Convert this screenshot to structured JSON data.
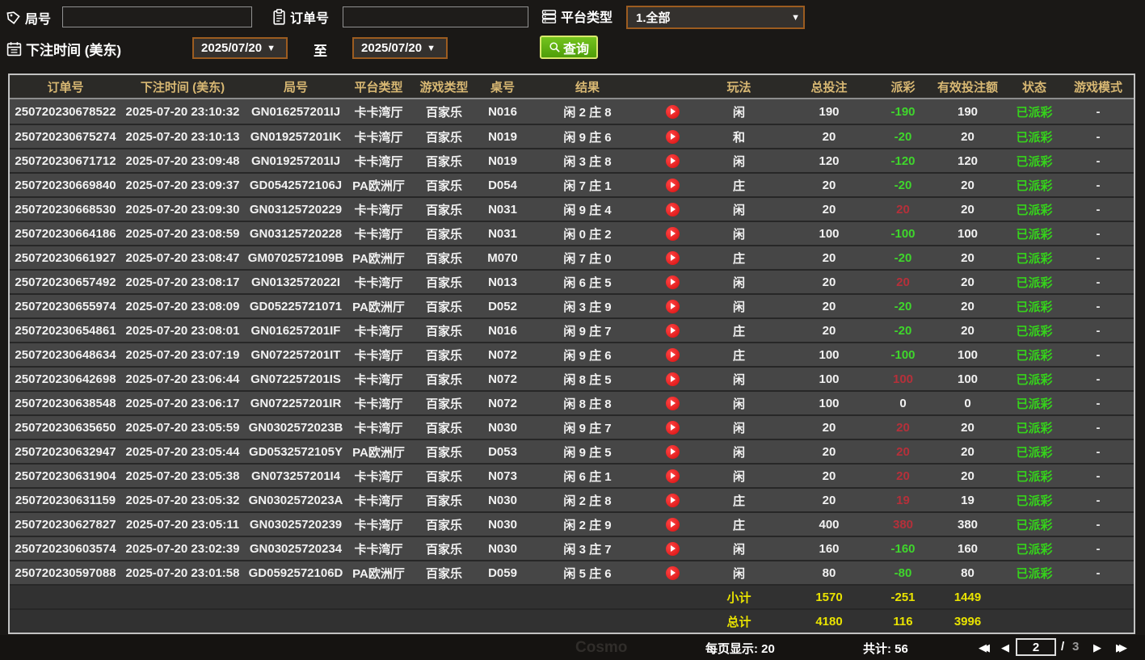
{
  "filters": {
    "game_id_label": "局号",
    "game_id_value": "",
    "order_id_label": "订单号",
    "order_id_value": "",
    "platform_label": "平台类型",
    "platform_value": "1.全部",
    "bet_time_label": "下注时间 (美东)",
    "date_from": "2025/07/20",
    "to_label": "至",
    "date_to": "2025/07/20",
    "search_label": "查询",
    "caret": "▼"
  },
  "table": {
    "headers": [
      "订单号",
      "下注时间 (美东)",
      "局号",
      "平台类型",
      "游戏类型",
      "桌号",
      "结果",
      "玩法",
      "总投注",
      "派彩",
      "有效投注额",
      "状态",
      "游戏模式"
    ],
    "rows": [
      {
        "order": "250720230678522",
        "time": "2025-07-20 23:10:32",
        "round": "GN016257201IJ",
        "platform": "卡卡湾厅",
        "game": "百家乐",
        "tableNo": "N016",
        "result": "闲 2 庄 8",
        "play": "闲",
        "bet": "190",
        "payout": "-190",
        "payout_class": "pay-neg",
        "valid": "190",
        "status": "已派彩",
        "mode": "-"
      },
      {
        "order": "250720230675274",
        "time": "2025-07-20 23:10:13",
        "round": "GN019257201IK",
        "platform": "卡卡湾厅",
        "game": "百家乐",
        "tableNo": "N019",
        "result": "闲 9 庄 6",
        "play": "和",
        "bet": "20",
        "payout": "-20",
        "payout_class": "pay-neg",
        "valid": "20",
        "status": "已派彩",
        "mode": "-"
      },
      {
        "order": "250720230671712",
        "time": "2025-07-20 23:09:48",
        "round": "GN019257201IJ",
        "platform": "卡卡湾厅",
        "game": "百家乐",
        "tableNo": "N019",
        "result": "闲 3 庄 8",
        "play": "闲",
        "bet": "120",
        "payout": "-120",
        "payout_class": "pay-neg",
        "valid": "120",
        "status": "已派彩",
        "mode": "-"
      },
      {
        "order": "250720230669840",
        "time": "2025-07-20 23:09:37",
        "round": "GD0542572106J",
        "platform": "PA欧洲厅",
        "game": "百家乐",
        "tableNo": "D054",
        "result": "闲 7 庄 1",
        "play": "庄",
        "bet": "20",
        "payout": "-20",
        "payout_class": "pay-neg",
        "valid": "20",
        "status": "已派彩",
        "mode": "-"
      },
      {
        "order": "250720230668530",
        "time": "2025-07-20 23:09:30",
        "round": "GN03125720229",
        "platform": "卡卡湾厅",
        "game": "百家乐",
        "tableNo": "N031",
        "result": "闲 9 庄 4",
        "play": "闲",
        "bet": "20",
        "payout": "20",
        "payout_class": "pay-pos",
        "valid": "20",
        "status": "已派彩",
        "mode": "-"
      },
      {
        "order": "250720230664186",
        "time": "2025-07-20 23:08:59",
        "round": "GN03125720228",
        "platform": "卡卡湾厅",
        "game": "百家乐",
        "tableNo": "N031",
        "result": "闲 0 庄 2",
        "play": "闲",
        "bet": "100",
        "payout": "-100",
        "payout_class": "pay-neg",
        "valid": "100",
        "status": "已派彩",
        "mode": "-"
      },
      {
        "order": "250720230661927",
        "time": "2025-07-20 23:08:47",
        "round": "GM0702572109B",
        "platform": "PA欧洲厅",
        "game": "百家乐",
        "tableNo": "M070",
        "result": "闲 7 庄 0",
        "play": "庄",
        "bet": "20",
        "payout": "-20",
        "payout_class": "pay-neg",
        "valid": "20",
        "status": "已派彩",
        "mode": "-"
      },
      {
        "order": "250720230657492",
        "time": "2025-07-20 23:08:17",
        "round": "GN0132572022I",
        "platform": "卡卡湾厅",
        "game": "百家乐",
        "tableNo": "N013",
        "result": "闲 6 庄 5",
        "play": "闲",
        "bet": "20",
        "payout": "20",
        "payout_class": "pay-pos",
        "valid": "20",
        "status": "已派彩",
        "mode": "-"
      },
      {
        "order": "250720230655974",
        "time": "2025-07-20 23:08:09",
        "round": "GD05225721071",
        "platform": "PA欧洲厅",
        "game": "百家乐",
        "tableNo": "D052",
        "result": "闲 3 庄 9",
        "play": "闲",
        "bet": "20",
        "payout": "-20",
        "payout_class": "pay-neg",
        "valid": "20",
        "status": "已派彩",
        "mode": "-"
      },
      {
        "order": "250720230654861",
        "time": "2025-07-20 23:08:01",
        "round": "GN016257201IF",
        "platform": "卡卡湾厅",
        "game": "百家乐",
        "tableNo": "N016",
        "result": "闲 9 庄 7",
        "play": "庄",
        "bet": "20",
        "payout": "-20",
        "payout_class": "pay-neg",
        "valid": "20",
        "status": "已派彩",
        "mode": "-"
      },
      {
        "order": "250720230648634",
        "time": "2025-07-20 23:07:19",
        "round": "GN072257201IT",
        "platform": "卡卡湾厅",
        "game": "百家乐",
        "tableNo": "N072",
        "result": "闲 9 庄 6",
        "play": "庄",
        "bet": "100",
        "payout": "-100",
        "payout_class": "pay-neg",
        "valid": "100",
        "status": "已派彩",
        "mode": "-"
      },
      {
        "order": "250720230642698",
        "time": "2025-07-20 23:06:44",
        "round": "GN072257201IS",
        "platform": "卡卡湾厅",
        "game": "百家乐",
        "tableNo": "N072",
        "result": "闲 8 庄 5",
        "play": "闲",
        "bet": "100",
        "payout": "100",
        "payout_class": "pay-pos",
        "valid": "100",
        "status": "已派彩",
        "mode": "-"
      },
      {
        "order": "250720230638548",
        "time": "2025-07-20 23:06:17",
        "round": "GN072257201IR",
        "platform": "卡卡湾厅",
        "game": "百家乐",
        "tableNo": "N072",
        "result": "闲 8 庄 8",
        "play": "闲",
        "bet": "100",
        "payout": "0",
        "payout_class": "pay-zero",
        "valid": "0",
        "status": "已派彩",
        "mode": "-"
      },
      {
        "order": "250720230635650",
        "time": "2025-07-20 23:05:59",
        "round": "GN0302572023B",
        "platform": "卡卡湾厅",
        "game": "百家乐",
        "tableNo": "N030",
        "result": "闲 9 庄 7",
        "play": "闲",
        "bet": "20",
        "payout": "20",
        "payout_class": "pay-pos",
        "valid": "20",
        "status": "已派彩",
        "mode": "-"
      },
      {
        "order": "250720230632947",
        "time": "2025-07-20 23:05:44",
        "round": "GD0532572105Y",
        "platform": "PA欧洲厅",
        "game": "百家乐",
        "tableNo": "D053",
        "result": "闲 9 庄 5",
        "play": "闲",
        "bet": "20",
        "payout": "20",
        "payout_class": "pay-pos",
        "valid": "20",
        "status": "已派彩",
        "mode": "-"
      },
      {
        "order": "250720230631904",
        "time": "2025-07-20 23:05:38",
        "round": "GN073257201I4",
        "platform": "卡卡湾厅",
        "game": "百家乐",
        "tableNo": "N073",
        "result": "闲 6 庄 1",
        "play": "闲",
        "bet": "20",
        "payout": "20",
        "payout_class": "pay-pos",
        "valid": "20",
        "status": "已派彩",
        "mode": "-"
      },
      {
        "order": "250720230631159",
        "time": "2025-07-20 23:05:32",
        "round": "GN0302572023A",
        "platform": "卡卡湾厅",
        "game": "百家乐",
        "tableNo": "N030",
        "result": "闲 2 庄 8",
        "play": "庄",
        "bet": "20",
        "payout": "19",
        "payout_class": "pay-pos",
        "valid": "19",
        "status": "已派彩",
        "mode": "-"
      },
      {
        "order": "250720230627827",
        "time": "2025-07-20 23:05:11",
        "round": "GN03025720239",
        "platform": "卡卡湾厅",
        "game": "百家乐",
        "tableNo": "N030",
        "result": "闲 2 庄 9",
        "play": "庄",
        "bet": "400",
        "payout": "380",
        "payout_class": "pay-pos",
        "valid": "380",
        "status": "已派彩",
        "mode": "-"
      },
      {
        "order": "250720230603574",
        "time": "2025-07-20 23:02:39",
        "round": "GN03025720234",
        "platform": "卡卡湾厅",
        "game": "百家乐",
        "tableNo": "N030",
        "result": "闲 3 庄 7",
        "play": "闲",
        "bet": "160",
        "payout": "-160",
        "payout_class": "pay-neg",
        "valid": "160",
        "status": "已派彩",
        "mode": "-"
      },
      {
        "order": "250720230597088",
        "time": "2025-07-20 23:01:58",
        "round": "GD0592572106D",
        "platform": "PA欧洲厅",
        "game": "百家乐",
        "tableNo": "D059",
        "result": "闲 5 庄 6",
        "play": "闲",
        "bet": "80",
        "payout": "-80",
        "payout_class": "pay-neg",
        "valid": "80",
        "status": "已派彩",
        "mode": "-"
      }
    ],
    "subtotal": {
      "label": "小计",
      "bet": "1570",
      "payout": "-251",
      "valid": "1449"
    },
    "grand_total": {
      "label": "总计",
      "bet": "4180",
      "payout": "116",
      "valid": "3996"
    }
  },
  "pagination": {
    "page_size_label": "每页显示: 20",
    "total_label": "共计: 56",
    "current_page": "2",
    "separator": "/",
    "total_pages": "3",
    "icons": {
      "first": "◀◀",
      "prev": "◀",
      "next": "▶",
      "last": "▶▶"
    }
  },
  "watermark": "Cosmo",
  "colors": {
    "page_bg": "#1a1816",
    "row_bg": "#464646",
    "header_bg": "#2b2a27",
    "header_text": "#d8b873",
    "payout_positive_red": "#b5303a",
    "payout_negative_green": "#3fd62c",
    "status_green": "#35d31b",
    "totals_yellow": "#e9e300",
    "search_button_green": "#5aae13",
    "box_border_orange": "#9c5c20",
    "table_border": "#c2c2c2"
  }
}
